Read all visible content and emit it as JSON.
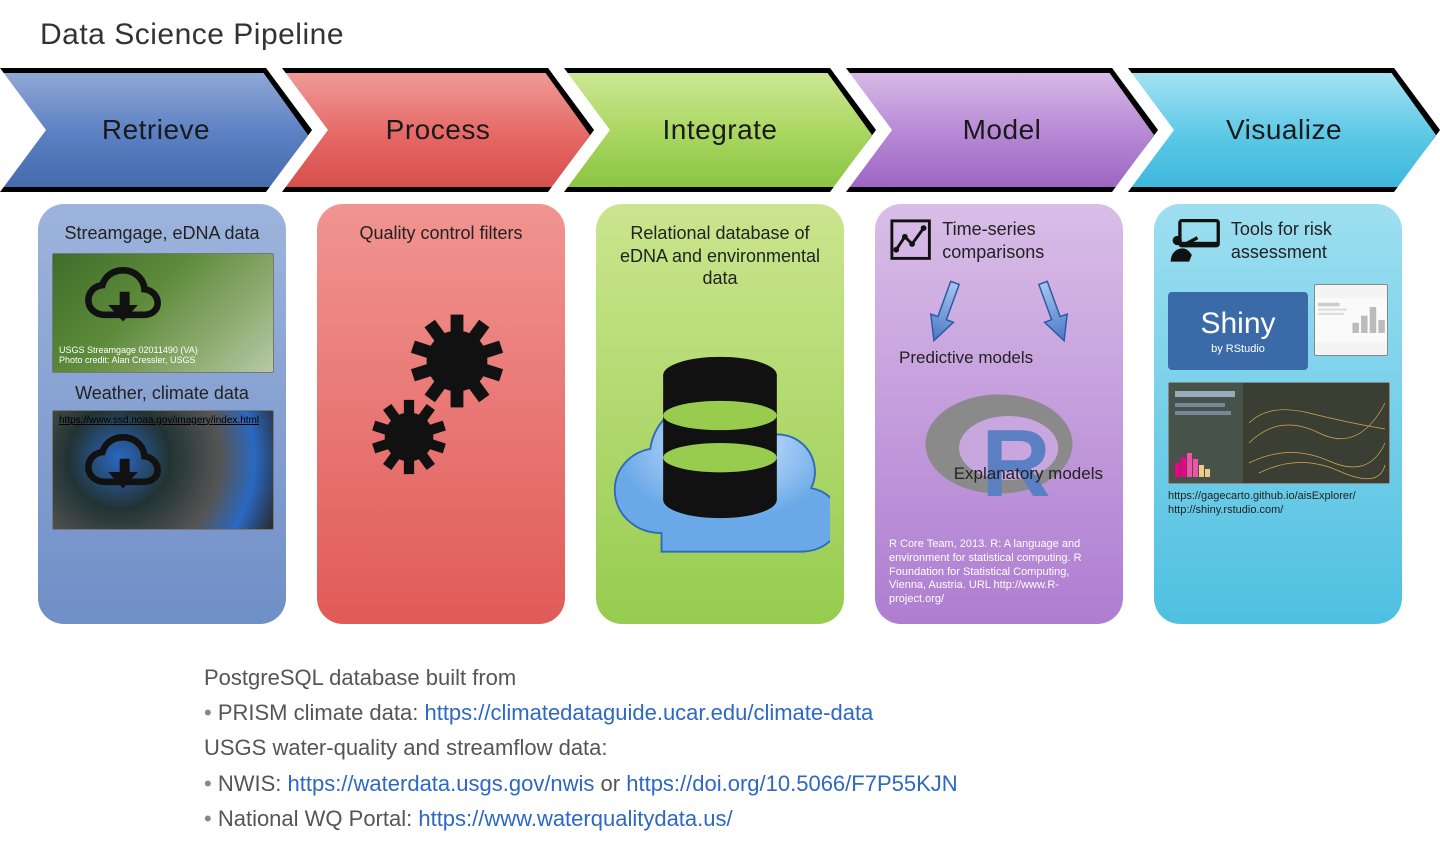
{
  "title": "Data Science Pipeline",
  "steps": [
    {
      "label": "Retrieve",
      "card_title": "Streamgage, eDNA data",
      "card_sub": "Weather, climate data",
      "cap1": "USGS Streamgage 02011490 (VA)\nPhoto credit: Alan Cressler, USGS",
      "cap2": "https://www.ssd.noaa.gov/imagery/index.html"
    },
    {
      "label": "Process",
      "card_title": "Quality control filters"
    },
    {
      "label": "Integrate",
      "card_title": "Relational database of eDNA and environmental data"
    },
    {
      "label": "Model",
      "card_title": "Time-series comparisons",
      "predictive": "Predictive models",
      "explanatory": "Explanatory models",
      "cite": "R Core Team, 2013. R: A language and environment for statistical computing. R Foundation for Statistical Computing, Vienna, Austria. URL http://www.R-project.org/"
    },
    {
      "label": "Visualize",
      "card_title": "Tools for risk assessment",
      "shiny_big": "Shiny",
      "shiny_small": "by RStudio",
      "links": "https://gagecarto.github.io/aisExplorer/\nhttp://shiny.rstudio.com/"
    }
  ],
  "footer": {
    "l1": "PostgreSQL database built from",
    "l2_pre": "PRISM climate data: ",
    "l2_link": "https://climatedataguide.ucar.edu/climate-data",
    "l3": "USGS water-quality and streamflow data:",
    "l4_pre": "NWIS: ",
    "l4_link1": "https://waterdata.usgs.gov/nwis",
    "l4_mid": " or ",
    "l4_link2": "https://doi.org/10.5066/F7P55KJN",
    "l5_pre": "National WQ Portal: ",
    "l5_link": "https://www.waterqualitydata.us/"
  }
}
